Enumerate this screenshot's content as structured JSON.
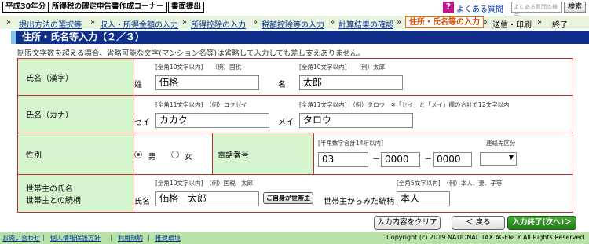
{
  "header": {
    "year": "平成30年分",
    "title": "所得税の確定申告書作成コーナー",
    "print": "書面提出",
    "help_link": "よくある質問",
    "search_placeholder": "よくある質問の検索",
    "search_button": "検索"
  },
  "steps": {
    "items": [
      {
        "label": "提出方法の選択等"
      },
      {
        "label": "収入・所得金額の入力"
      },
      {
        "label": "所得控除の入力"
      },
      {
        "label": "税額控除等の入力"
      },
      {
        "label": "計算結果の確認"
      },
      {
        "label": "住所・氏名等の入力"
      },
      {
        "label": "送信・印刷"
      },
      {
        "label": "終了"
      }
    ]
  },
  "page": {
    "title": "住所・氏名等入力（２／３）",
    "note": "制限文字数を超える場合、省略可能な文字(マンション名等)は省略して入力しても差し支えありません。"
  },
  "form": {
    "kanji": {
      "label": "氏名（漢字）",
      "sei_hint": "[全角10文字以内]　　（例）国税",
      "mei_hint": "[全角10文字以内]　　（例）太郎",
      "sei_label": "姓",
      "mei_label": "名",
      "sei_value": "価格",
      "mei_value": "太郎"
    },
    "kana": {
      "label": "氏名（カナ）",
      "sei_hint": "[全角11文字以内]　（例）コクゼイ",
      "mei_hint": "[全角11文字以内]　（例）タロウ　※「セイ」と「メイ」欄の合計で12文字以内",
      "sei_label": "セイ",
      "mei_label": "メイ",
      "sei_value": "カカク",
      "mei_value": "タロウ"
    },
    "gender": {
      "label": "性別",
      "male": "男",
      "female": "女",
      "selected": "男"
    },
    "phone": {
      "label": "電話番号",
      "hint": "[半角数字合計14桁以内]",
      "type_hint": "連絡先区分",
      "p1": "03",
      "p2": "0000",
      "p3": "0000",
      "type_value": ""
    },
    "householder": {
      "label_line1": "世帯主の氏名",
      "label_line2": "世帯主との続柄",
      "name_hint": "[全角10文字以内]　（例）国税　太郎",
      "name_label": "氏名",
      "name_value": "価格　太郎",
      "self_button": "ご自身が世帯主",
      "rel_hint": "[全角5文字以内]　（例）本人、妻、子等",
      "rel_label": "世帯主からみた続柄",
      "rel_value": "本人"
    }
  },
  "buttons": {
    "clear": "入力内容をクリア",
    "back": "＜ 戻る",
    "next": "入力終了(次へ)＞"
  },
  "footer": {
    "links": [
      "お問い合わせ",
      "個人情報保護方針",
      "利用規約",
      "推奨環境"
    ],
    "copyright": "Copyright (c) 2019 NATIONAL TAX AGENCY All Rights Reserved."
  }
}
